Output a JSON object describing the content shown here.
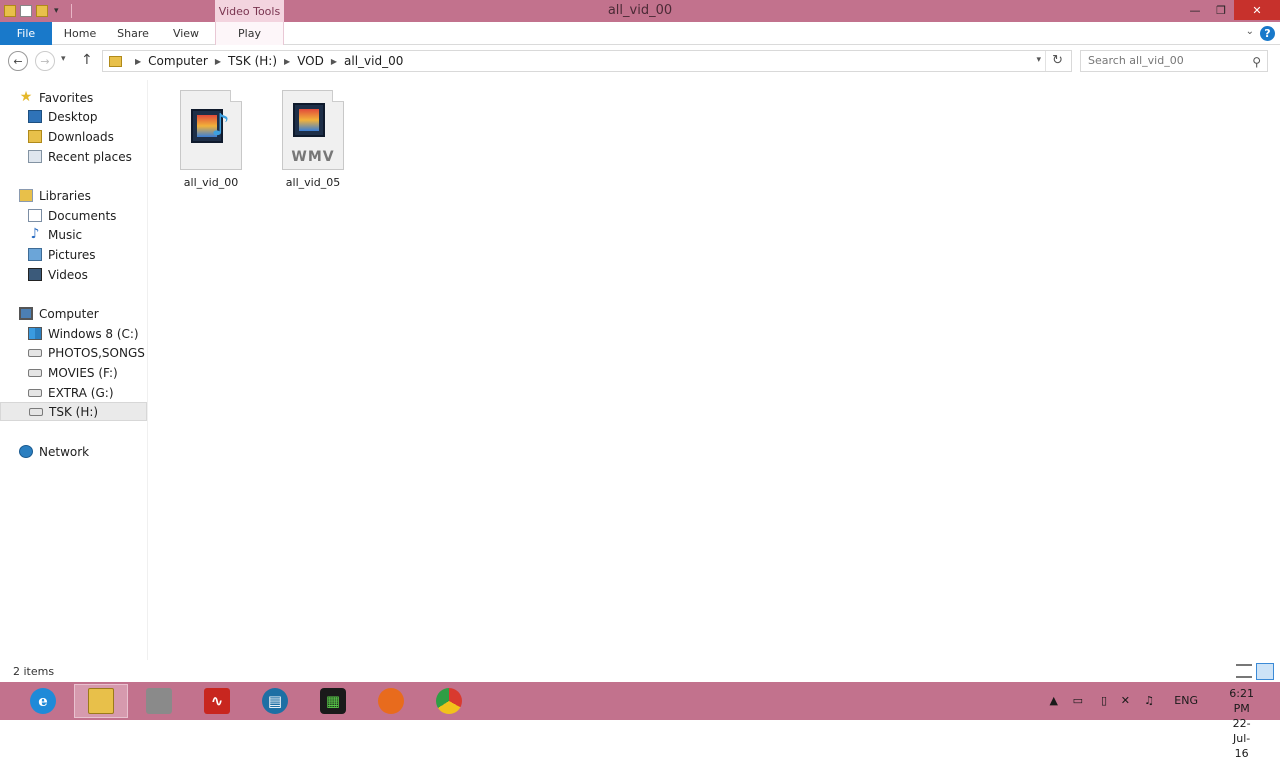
{
  "window": {
    "title": "all_vid_00",
    "context_tab_group": "Video Tools",
    "min_glyph": "—",
    "max_glyph": "❐",
    "close_glyph": "✕"
  },
  "ribbon": {
    "tabs": [
      "File",
      "Home",
      "Share",
      "View",
      "Play"
    ],
    "help_glyph": "?"
  },
  "nav": {
    "breadcrumb": [
      "Computer",
      "TSK (H:)",
      "VOD",
      "all_vid_00"
    ],
    "search_placeholder": "Search all_vid_00"
  },
  "sidebar": {
    "favorites": {
      "label": "Favorites",
      "items": [
        "Desktop",
        "Downloads",
        "Recent places"
      ]
    },
    "libraries": {
      "label": "Libraries",
      "items": [
        "Documents",
        "Music",
        "Pictures",
        "Videos"
      ]
    },
    "computer": {
      "label": "Computer",
      "items": [
        "Windows 8 (C:)",
        "PHOTOS,SONGS & VIDEOS (E:)",
        "MOVIES (F:)",
        "EXTRA (G:)",
        "TSK (H:)"
      ]
    },
    "network": {
      "label": "Network"
    },
    "selected": "TSK (H:)"
  },
  "files": [
    {
      "name": "all_vid_00",
      "type": "video-audio"
    },
    {
      "name": "all_vid_05",
      "type": "wmv",
      "badge": "WMV"
    }
  ],
  "status": {
    "item_count": "2 items"
  },
  "taskbar": {
    "apps": [
      "internet-explorer",
      "file-explorer",
      "system-tool",
      "audio-editor",
      "media-center",
      "movie-maker",
      "firefox",
      "chrome"
    ],
    "ie_glyph": "e",
    "lang": "ENG",
    "time": "6:21 PM",
    "date": "22-Jul-16"
  },
  "colors": {
    "accent": "#1979ca",
    "titlebar": "#c2728d",
    "close": "#c7312c"
  }
}
